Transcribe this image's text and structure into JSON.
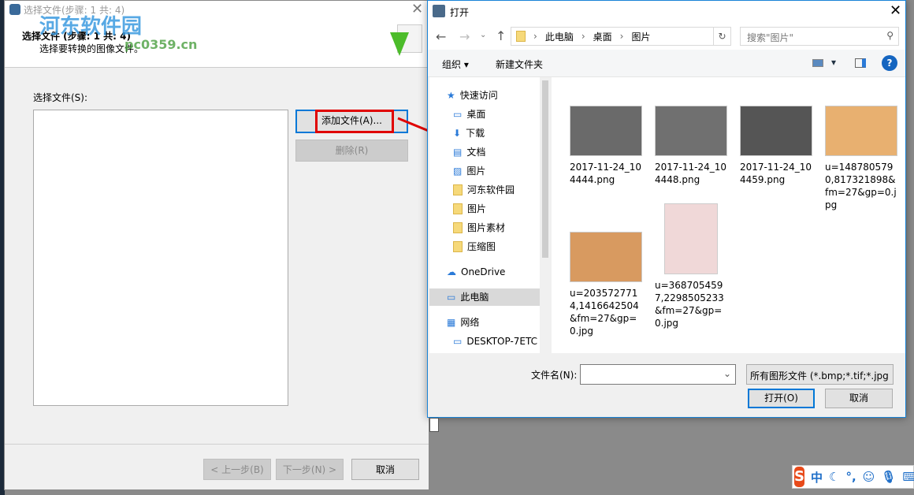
{
  "wizard": {
    "title": "选择文件(步骤: 1 共: 4)",
    "heading": "选择文件 (步骤: 1 共: 4)",
    "subheading": "选择要转换的图像文件。",
    "list_label": "选择文件(S):",
    "add_button": "添加文件(A)...",
    "delete_button": "删除(R)",
    "prev_button": "< 上一步(B)",
    "next_button": "下一步(N) >",
    "cancel_button": "取消"
  },
  "watermark": {
    "name": "河东软件园",
    "url": "pc0359.cn"
  },
  "open_dialog": {
    "title": "打开",
    "breadcrumb": [
      "此电脑",
      "桌面",
      "图片"
    ],
    "search_placeholder": "搜索\"图片\"",
    "organize": "组织",
    "new_folder": "新建文件夹",
    "nav": [
      {
        "label": "快速访问",
        "icon": "star-icon"
      },
      {
        "label": "桌面",
        "icon": "desktop-icon"
      },
      {
        "label": "下载",
        "icon": "download-icon"
      },
      {
        "label": "文档",
        "icon": "document-icon"
      },
      {
        "label": "图片",
        "icon": "pictures-icon"
      },
      {
        "label": "河东软件园",
        "icon": "folder-icon"
      },
      {
        "label": "图片",
        "icon": "folder-icon"
      },
      {
        "label": "图片素材",
        "icon": "folder-icon"
      },
      {
        "label": "压缩图",
        "icon": "folder-icon"
      },
      {
        "label": "OneDrive",
        "icon": "cloud-icon"
      },
      {
        "label": "此电脑",
        "icon": "computer-icon"
      },
      {
        "label": "网络",
        "icon": "network-icon"
      },
      {
        "label": "DESKTOP-7ETC",
        "icon": "computer-icon"
      }
    ],
    "files": [
      {
        "name": "2017-11-24_104444.png",
        "color": "#6a6a6a"
      },
      {
        "name": "2017-11-24_104448.png",
        "color": "#707070"
      },
      {
        "name": "2017-11-24_104459.png",
        "color": "#555555"
      },
      {
        "name": "u=1487805790,817321898&fm=27&gp=0.jpg",
        "color": "#e8b070"
      },
      {
        "name": "u=2035727714,1416642504&fm=27&gp=0.jpg",
        "color": "#d89a60"
      },
      {
        "name": "u=3687054597,2298505233&fm=27&gp=0.jpg",
        "color": "#f0d8d8"
      }
    ],
    "filename_label": "文件名(N):",
    "filename_value": "",
    "filter": "所有图形文件 (*.bmp;*.tif;*.jpg",
    "open_button": "打开(O)",
    "cancel_button": "取消"
  },
  "ime": {
    "mode": "中"
  }
}
